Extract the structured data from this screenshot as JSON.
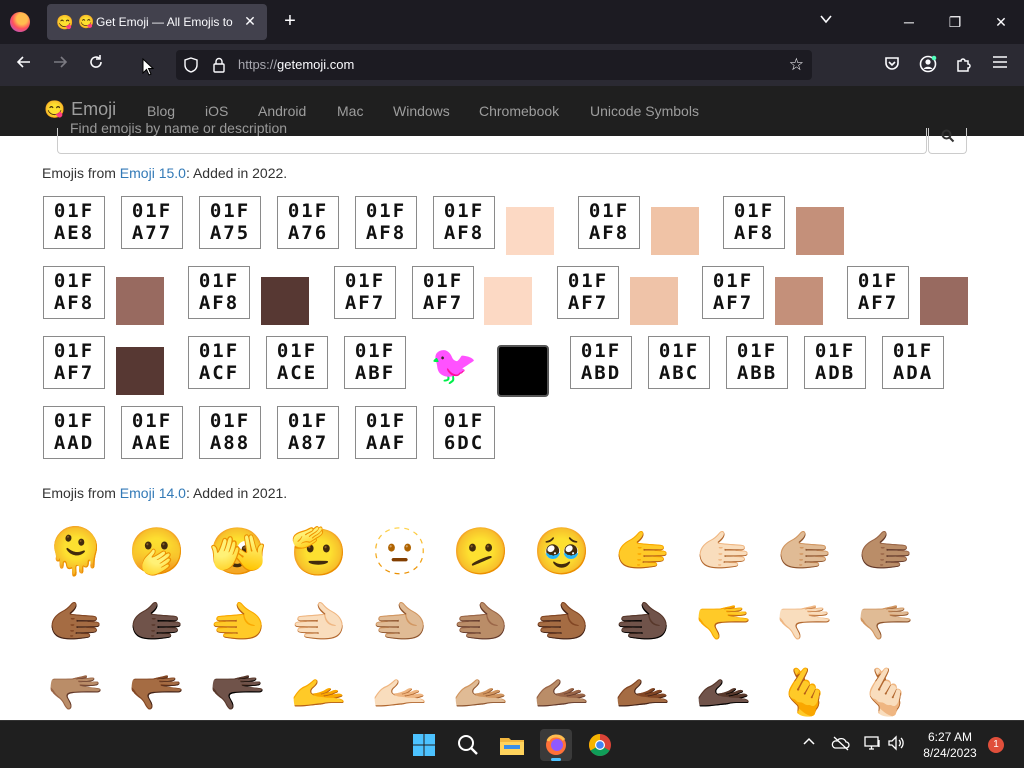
{
  "browser": {
    "tab": {
      "favicon": "😋",
      "title_emoji": "😋",
      "title": "Get Emoji — All Emojis to",
      "close": "✕"
    },
    "new_tab": "+",
    "url_proto": "https://",
    "url_host": "getemoji.com",
    "window_controls": {
      "minimize": "─",
      "restore": "❐",
      "close": "✕"
    }
  },
  "site": {
    "brand_emoji": "😋",
    "brand_name": "Emoji",
    "nav": [
      "Blog",
      "iOS",
      "Android",
      "Mac",
      "Windows",
      "Chromebook",
      "Unicode Symbols"
    ],
    "search_placeholder": "Find emojis by name or description"
  },
  "sections": [
    {
      "prefix": "Emojis from ",
      "link": "Emoji 15.0",
      "suffix": ": Added in 2022."
    },
    {
      "prefix": "Emojis from ",
      "link": "Emoji 14.0",
      "suffix": ": Added in 2021."
    }
  ],
  "emoji15_row1": [
    {
      "kind": "tofu",
      "l1": "01F",
      "l2": "AE8"
    },
    {
      "kind": "tofu",
      "l1": "01F",
      "l2": "A77"
    },
    {
      "kind": "tofu",
      "l1": "01F",
      "l2": "A75"
    },
    {
      "kind": "tofu",
      "l1": "01F",
      "l2": "A76"
    },
    {
      "kind": "tofu",
      "l1": "01F",
      "l2": "AF8"
    },
    {
      "kind": "tofu",
      "l1": "01F",
      "l2": "AF8"
    },
    {
      "kind": "swatch",
      "color": "#fcd9c4"
    },
    {
      "kind": "tofu",
      "l1": "01F",
      "l2": "AF8"
    },
    {
      "kind": "swatch",
      "color": "#f0c3a6"
    },
    {
      "kind": "tofu",
      "l1": "01F",
      "l2": "AF8"
    },
    {
      "kind": "swatch",
      "color": "#c4907a"
    }
  ],
  "emoji15_row2": [
    {
      "kind": "tofu",
      "l1": "01F",
      "l2": "AF8"
    },
    {
      "kind": "swatch",
      "color": "#986a60"
    },
    {
      "kind": "tofu",
      "l1": "01F",
      "l2": "AF8"
    },
    {
      "kind": "swatch",
      "color": "#573833"
    },
    {
      "kind": "tofu",
      "l1": "01F",
      "l2": "AF7"
    },
    {
      "kind": "tofu",
      "l1": "01F",
      "l2": "AF7"
    },
    {
      "kind": "swatch",
      "color": "#fcd9c4"
    },
    {
      "kind": "tofu",
      "l1": "01F",
      "l2": "AF7"
    },
    {
      "kind": "swatch",
      "color": "#efc3a8"
    },
    {
      "kind": "tofu",
      "l1": "01F",
      "l2": "AF7"
    },
    {
      "kind": "swatch",
      "color": "#c4907a"
    },
    {
      "kind": "tofu",
      "l1": "01F",
      "l2": "AF7"
    },
    {
      "kind": "swatch",
      "color": "#986a60"
    }
  ],
  "emoji15_row3": [
    {
      "kind": "tofu",
      "l1": "01F",
      "l2": "AF7"
    },
    {
      "kind": "swatch",
      "color": "#573833"
    },
    {
      "kind": "tofu",
      "l1": "01F",
      "l2": "ACF"
    },
    {
      "kind": "tofu",
      "l1": "01F",
      "l2": "ACE"
    },
    {
      "kind": "tofu",
      "l1": "01F",
      "l2": "ABF"
    },
    {
      "kind": "bird",
      "glyph": "🐦"
    },
    {
      "kind": "black"
    },
    {
      "kind": "tofu",
      "l1": "01F",
      "l2": "ABD"
    },
    {
      "kind": "tofu",
      "l1": "01F",
      "l2": "ABC"
    },
    {
      "kind": "tofu",
      "l1": "01F",
      "l2": "ABB"
    },
    {
      "kind": "tofu",
      "l1": "01F",
      "l2": "ADB"
    },
    {
      "kind": "tofu",
      "l1": "01F",
      "l2": "ADA"
    }
  ],
  "emoji15_row4": [
    {
      "kind": "tofu",
      "l1": "01F",
      "l2": "AAD"
    },
    {
      "kind": "tofu",
      "l1": "01F",
      "l2": "AAE"
    },
    {
      "kind": "tofu",
      "l1": "01F",
      "l2": "A88"
    },
    {
      "kind": "tofu",
      "l1": "01F",
      "l2": "A87"
    },
    {
      "kind": "tofu",
      "l1": "01F",
      "l2": "AAF"
    },
    {
      "kind": "tofu",
      "l1": "01F",
      "l2": "6DC"
    }
  ],
  "emoji14_rows": [
    [
      "🫠",
      "🫢",
      "🫣",
      "🫡",
      "🫥",
      "🫤",
      "🥹",
      "🫱",
      "🫱🏻",
      "🫱🏼",
      "🫱🏽"
    ],
    [
      "🫱🏾",
      "🫱🏿",
      "🫲",
      "🫲🏻",
      "🫲🏼",
      "🫲🏽",
      "🫲🏾",
      "🫲🏿",
      "🫳",
      "🫳🏻",
      "🫳🏼"
    ],
    [
      "🫳🏽",
      "🫳🏾",
      "🫳🏿",
      "🫴",
      "🫴🏻",
      "🫴🏼",
      "🫴🏽",
      "🫴🏾",
      "🫴🏿",
      "🫰",
      "🫰🏻"
    ]
  ],
  "taskbar": {
    "clock_time": "6:27 AM",
    "clock_date": "8/24/2023",
    "notifications": "1"
  }
}
